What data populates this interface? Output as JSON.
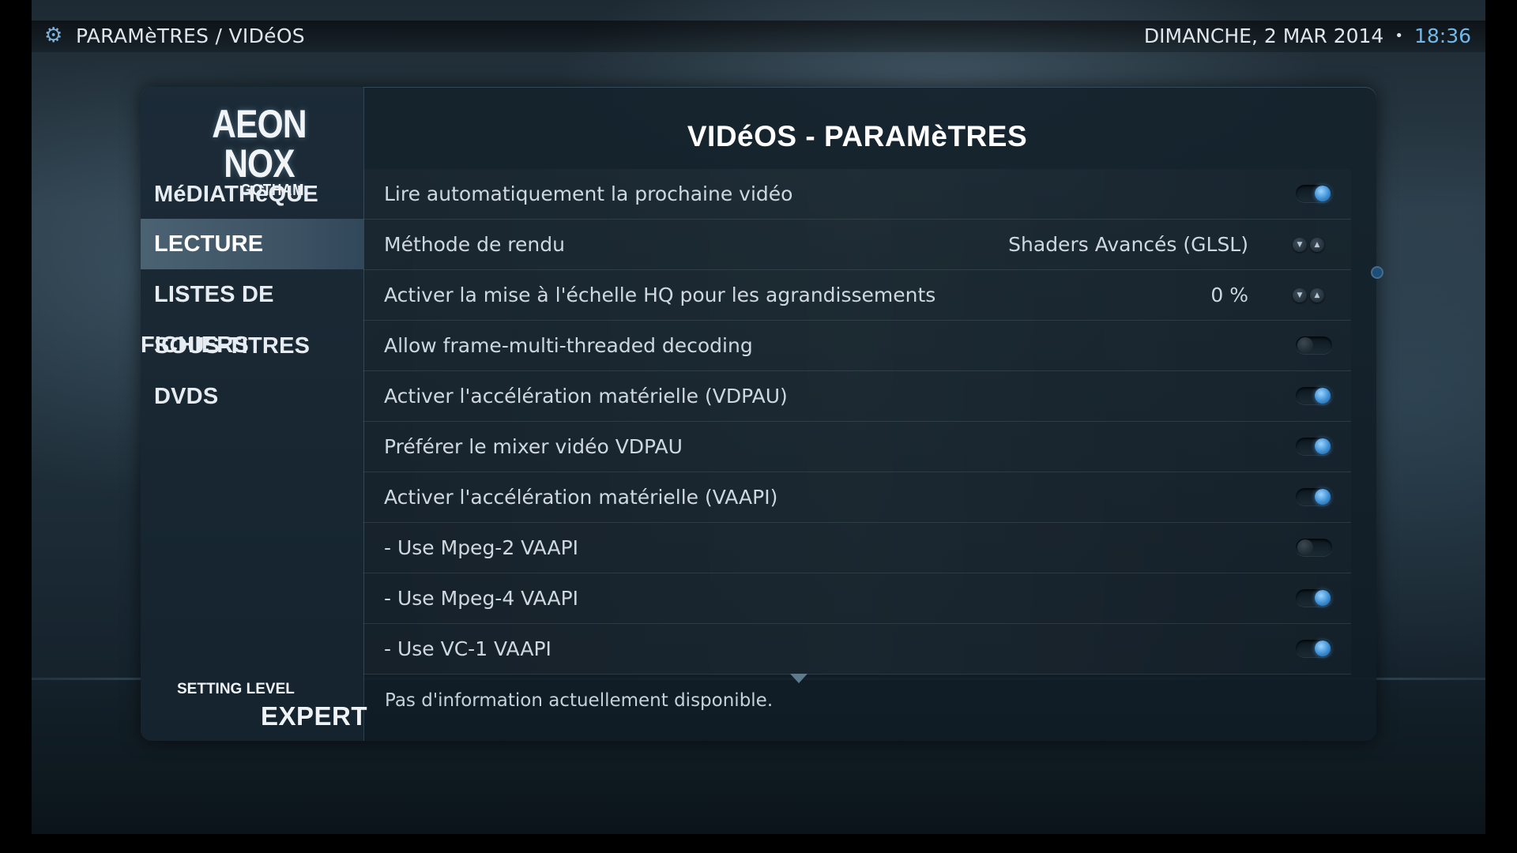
{
  "header": {
    "breadcrumb": "PARAMèTRES / VIDéOS",
    "date": "DIMANCHE, 2 MAR 2014",
    "separator": "•",
    "time": "18:36"
  },
  "logo": {
    "main": "AEON NOX",
    "sub": "GOTHAM"
  },
  "page_title": "VIDéOS - PARAMèTRES",
  "categories": [
    {
      "label": "MéDIATHèQUE",
      "active": false
    },
    {
      "label": "LECTURE",
      "active": true
    },
    {
      "label": "LISTES DE FICHIERS",
      "active": false
    },
    {
      "label": "SOUS-TITRES",
      "active": false
    },
    {
      "label": "DVDS",
      "active": false
    }
  ],
  "settings": [
    {
      "label": "Lire automatiquement la prochaine vidéo",
      "type": "toggle",
      "state": "on"
    },
    {
      "label": "Méthode de rendu",
      "type": "spinner",
      "value": "Shaders Avancés (GLSL)"
    },
    {
      "label": "Activer la mise à l'échelle HQ pour les agrandissements",
      "type": "spinner",
      "value": "0 %"
    },
    {
      "label": "Allow frame-multi-threaded decoding",
      "type": "toggle",
      "state": "off"
    },
    {
      "label": "Activer l'accélération matérielle (VDPAU)",
      "type": "toggle",
      "state": "on"
    },
    {
      "label": "Préférer le mixer vidéo VDPAU",
      "type": "toggle",
      "state": "on"
    },
    {
      "label": "Activer l'accélération matérielle (VAAPI)",
      "type": "toggle",
      "state": "on"
    },
    {
      "label": "- Use Mpeg-2 VAAPI",
      "type": "toggle",
      "state": "off"
    },
    {
      "label": "- Use Mpeg-4 VAAPI",
      "type": "toggle",
      "state": "on"
    },
    {
      "label": "- Use VC-1 VAAPI",
      "type": "toggle",
      "state": "on"
    }
  ],
  "setting_level": {
    "label": "SETTING LEVEL",
    "value": "EXPERT"
  },
  "info_text": "Pas d'information actuellement disponible.",
  "icons": {
    "gear": "gear-icon",
    "spin_down": "arrow-down-icon",
    "spin_up": "arrow-up-icon"
  },
  "colors": {
    "accent": "#6fb8ec",
    "toggle_on": "#3d8fd6"
  }
}
